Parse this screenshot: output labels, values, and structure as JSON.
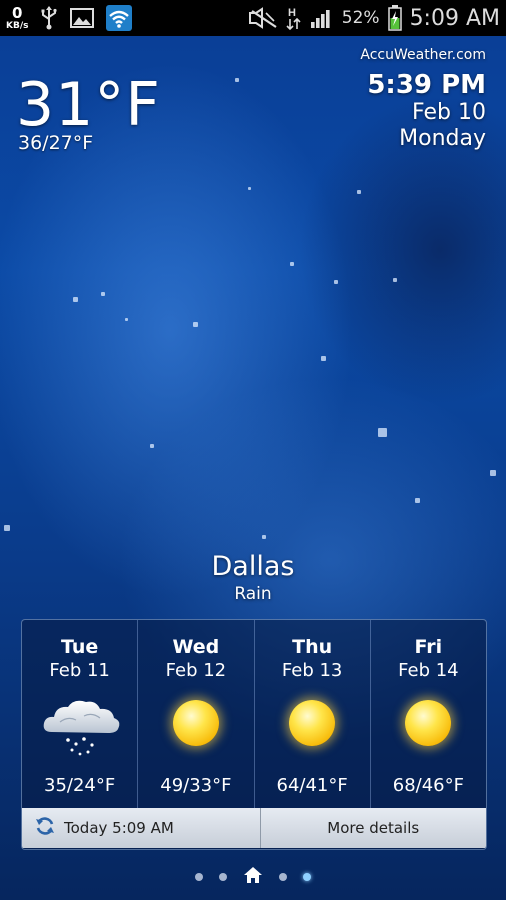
{
  "status_bar": {
    "net_speed_value": "0",
    "net_speed_unit": "KB/s",
    "icons_left": [
      "usb-icon",
      "image-icon",
      "wifi-icon"
    ],
    "icons_right": [
      "mute-icon",
      "hspa-icon",
      "signal-icon",
      "battery-icon"
    ],
    "hspa_label": "H",
    "battery_percent": "52%",
    "time": "5:09 AM"
  },
  "weather": {
    "current_temp": "31°F",
    "temp_range": "36/27°F",
    "provider": "AccuWeather.com",
    "time": "5:39 PM",
    "date": "Feb 10",
    "weekday": "Monday",
    "city": "Dallas",
    "condition": "Rain"
  },
  "forecast": [
    {
      "day": "Tue",
      "date": "Feb 11",
      "icon": "snow-cloud-icon",
      "range": "35/24°F"
    },
    {
      "day": "Wed",
      "date": "Feb 12",
      "icon": "sun-icon",
      "range": "49/33°F"
    },
    {
      "day": "Thu",
      "date": "Feb 13",
      "icon": "sun-icon",
      "range": "64/41°F"
    },
    {
      "day": "Fri",
      "date": "Feb 14",
      "icon": "sun-icon",
      "range": "68/46°F"
    }
  ],
  "footer": {
    "refresh_label": "Today 5:09 AM",
    "more_label": "More details"
  },
  "pager": {
    "pages": 5,
    "home_index": 2,
    "current_index": 4
  },
  "colors": {
    "background": "#0b4aa6",
    "accent_dot": "#8fd0ff",
    "sun": "#ffe54a"
  }
}
